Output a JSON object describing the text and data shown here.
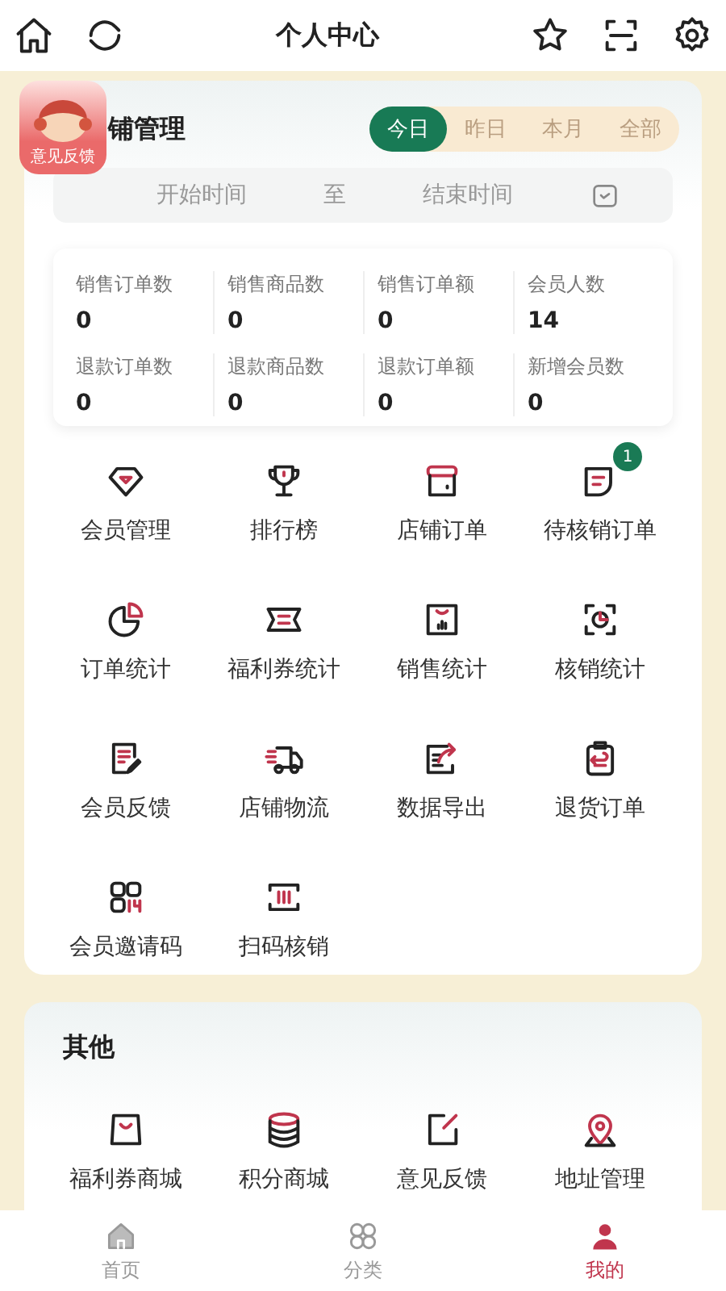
{
  "header": {
    "title": "个人中心"
  },
  "feedback_float": {
    "label": "意见反馈"
  },
  "store": {
    "title": "铺管理",
    "periods": [
      {
        "label": "今日",
        "selected": true
      },
      {
        "label": "昨日",
        "selected": false
      },
      {
        "label": "本月",
        "selected": false
      },
      {
        "label": "全部",
        "selected": false
      }
    ],
    "date_range": {
      "start_placeholder": "开始时间",
      "separator": "至",
      "end_placeholder": "结束时间"
    },
    "stats": [
      {
        "label": "销售订单数",
        "value": "0"
      },
      {
        "label": "销售商品数",
        "value": "0"
      },
      {
        "label": "销售订单额",
        "value": "0"
      },
      {
        "label": "会员人数",
        "value": "14"
      },
      {
        "label": "退款订单数",
        "value": "0"
      },
      {
        "label": "退款商品数",
        "value": "0"
      },
      {
        "label": "退款订单额",
        "value": "0"
      },
      {
        "label": "新增会员数",
        "value": "0"
      }
    ],
    "functions": [
      {
        "label": "会员管理"
      },
      {
        "label": "排行榜"
      },
      {
        "label": "店铺订单"
      },
      {
        "label": "待核销订单",
        "badge": "1"
      },
      {
        "label": "订单统计"
      },
      {
        "label": "福利券统计"
      },
      {
        "label": "销售统计"
      },
      {
        "label": "核销统计"
      },
      {
        "label": "会员反馈"
      },
      {
        "label": "店铺物流"
      },
      {
        "label": "数据导出"
      },
      {
        "label": "退货订单"
      },
      {
        "label": "会员邀请码"
      },
      {
        "label": "扫码核销"
      }
    ]
  },
  "other": {
    "title": "其他",
    "functions": [
      {
        "label": "福利券商城"
      },
      {
        "label": "积分商城"
      },
      {
        "label": "意见反馈"
      },
      {
        "label": "地址管理"
      }
    ]
  },
  "tab_bar": [
    {
      "label": "首页",
      "selected": false
    },
    {
      "label": "分类",
      "selected": false
    },
    {
      "label": "我的",
      "selected": true
    }
  ]
}
